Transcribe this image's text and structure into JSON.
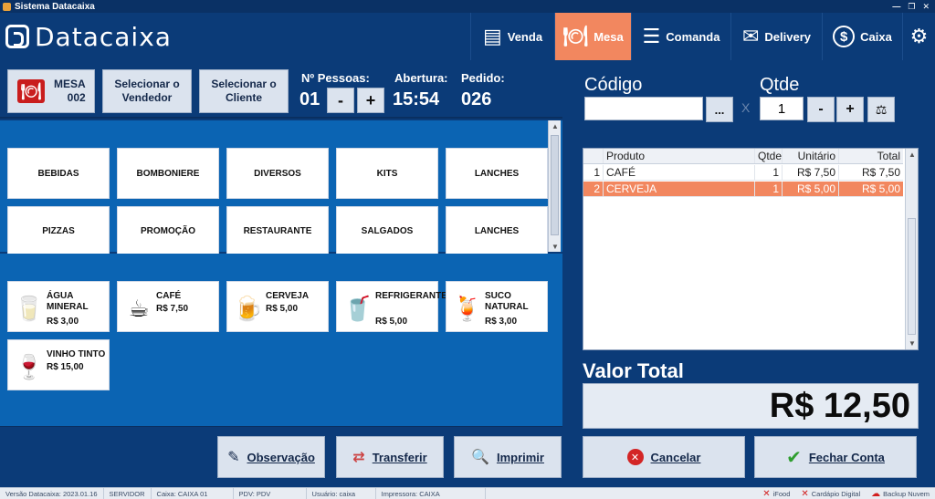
{
  "window": {
    "title": "Sistema Datacaixa"
  },
  "brand": {
    "name": "Datacaixa"
  },
  "nav": [
    {
      "label": "Venda",
      "icon": "cash-register-icon",
      "active": false
    },
    {
      "label": "Mesa",
      "icon": "dining-icon",
      "active": true
    },
    {
      "label": "Comanda",
      "icon": "checklist-icon",
      "active": false
    },
    {
      "label": "Delivery",
      "icon": "delivery-truck-icon",
      "active": false
    },
    {
      "label": "Caixa",
      "icon": "dollar-icon",
      "active": false
    }
  ],
  "mesa": {
    "label": "MESA",
    "number": "002",
    "select_vendedor": "Selecionar o Vendedor",
    "select_cliente": "Selecionar o Cliente",
    "pessoas_label": "Nº Pessoas:",
    "pessoas": "01",
    "minus": "-",
    "plus": "+",
    "abertura_label": "Abertura:",
    "abertura": "15:54",
    "pedido_label": "Pedido:",
    "pedido": "026"
  },
  "categories": [
    "BEBIDAS",
    "BOMBONIERE",
    "DIVERSOS",
    "KITS",
    "LANCHES",
    "PIZZAS",
    "PROMOÇÃO",
    "RESTAURANTE",
    "SALGADOS",
    "LANCHES"
  ],
  "products": [
    {
      "name": "ÁGUA MINERAL",
      "price": "R$ 3,00",
      "icon": "water-bottle-icon"
    },
    {
      "name": "CAFÉ",
      "price": "R$ 7,50",
      "icon": "coffee-cup-icon"
    },
    {
      "name": "CERVEJA",
      "price": "R$ 5,00",
      "icon": "beer-mug-icon"
    },
    {
      "name": "REFRIGERANTE",
      "price": "R$ 5,00",
      "icon": "soda-glass-icon"
    },
    {
      "name": "SUCO NATURAL",
      "price": "R$ 3,00",
      "icon": "juice-glass-icon"
    },
    {
      "name": "VINHO TINTO",
      "price": "R$ 15,00",
      "icon": "wine-bottle-icon"
    }
  ],
  "actions": {
    "observacao": "Observação",
    "transferir": "Transferir",
    "imprimir": "Imprimir",
    "cancelar": "Cancelar",
    "fechar": "Fechar Conta"
  },
  "entry": {
    "codigo_label": "Código",
    "codigo_value": "",
    "browse": "...",
    "separator": "X",
    "qtde_label": "Qtde",
    "qtde_value": "1",
    "minus": "-",
    "plus": "+"
  },
  "grid": {
    "columns": {
      "produto": "Produto",
      "qtde": "Qtde",
      "unitario": "Unitário",
      "total": "Total"
    },
    "rows": [
      {
        "n": "1",
        "produto": "CAFÉ",
        "qtde": "1",
        "unitario": "R$ 7,50",
        "total": "R$ 7,50",
        "selected": false
      },
      {
        "n": "2",
        "produto": "CERVEJA",
        "qtde": "1",
        "unitario": "R$ 5,00",
        "total": "R$ 5,00",
        "selected": true
      }
    ]
  },
  "total": {
    "label": "Valor Total",
    "value": "R$ 12,50"
  },
  "status": {
    "versao": "Versão Datacaixa: 2023.01.16",
    "servidor": "SERVIDOR",
    "caixa": "Caixa: CAIXA 01",
    "pdv": "PDV: PDV",
    "usuario": "Usuário: caixa",
    "impressora": "Impressora: CAIXA",
    "ifood": "iFood",
    "cardapio": "Cardápio Digital",
    "backup": "Backup Nuvem"
  },
  "colors": {
    "header": "#0b3b78",
    "active_tab": "#f2875f",
    "panel": "#0b64b3",
    "selected_row": "#f2875f"
  }
}
